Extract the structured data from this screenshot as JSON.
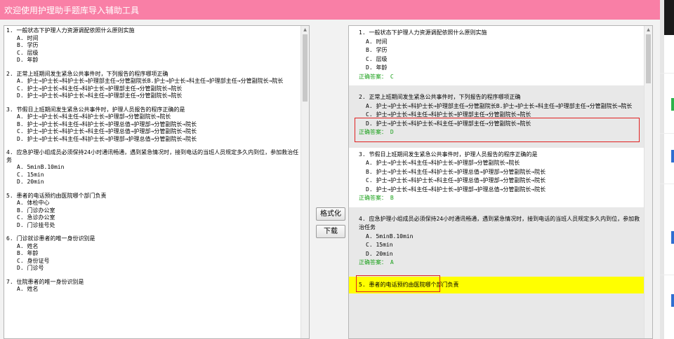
{
  "window": {
    "title": "欢迎使用护理助手题库导入辅助工具"
  },
  "buttons": {
    "format": "格式化",
    "download": "下载"
  },
  "left_questions": [
    {
      "q": "1. 一般状态下护理人力资源调配依照什么原则实施",
      "opts": [
        "A. 时间",
        "B. 学历",
        "C. 层级",
        "D. 年龄"
      ]
    },
    {
      "q": "2. 正常上班期间发生紧急公共事件时，下列报告的程序哪项正确",
      "opts": [
        "A. 护士→护士长→科护士长→护理部主任→分管副院长B.护士→护士长→科主任→护理部主任→分管副院长→院长",
        "C. 护士→护士长→科主任→科护士长→护理部主任→分管副院长→院长",
        "D. 护士→护士长→科护士长→科主任→护理部主任→分管副院长→院长"
      ]
    },
    {
      "q": "3. 节假日上班期间发生紧急公共事件时，护理人员报告的程序正确的是",
      "opts": [
        "A. 护士→护士长→科主任→科护士长→护理部→分管副院长→院长",
        "B. 护士→护士长→科主任→科护士长→护理总值→护理部→分管副院长→院长",
        "C. 护士→护士长→科护士长→科主任→护理总值→护理部→分管副院长→院长",
        "D. 护士→护士长→科主任→科护士长→护理部→护理总值→分管副院长→院长"
      ]
    },
    {
      "q": "4. 应急护理小组成员必须保持24小时通讯畅通，遇到紧急情况时，接到电话的当班人员规定多久内到位，参加救治任务",
      "opts": [
        "A. 5minB.10min",
        "C. 15min",
        "D. 20min"
      ]
    },
    {
      "q": "5. 患者的电话预约由医院哪个部门负责",
      "opts": [
        "A. 体检中心",
        "B. 门诊办公室",
        "C. 急诊办公室",
        "D. 门诊挂号处"
      ]
    },
    {
      "q": "6. 门诊就诊患者的唯一身份识别是",
      "opts": [
        "A. 姓名",
        "B. 年龄",
        "C. 身份证号",
        "D. 门诊号"
      ]
    },
    {
      "q": "7. 住院患者的唯一身份识别是",
      "opts": [
        "A. 姓名"
      ]
    }
  ],
  "right_questions": [
    {
      "q": "1. 一般状态下护理人力资源调配依照什么原则实施",
      "opts": [
        "A. 时间",
        "B. 学历",
        "C. 层级",
        "D. 年龄"
      ],
      "answer": "正确答案： C"
    },
    {
      "q": "2. 正常上班期间发生紧急公共事件时，下列报告的程序哪项正确",
      "opts": [
        "A. 护士→护士长→科护士长→护理部主任→分管副院长B.护士→护士长→科主任→护理部主任→分管副院长→院长",
        "C. 护士→护士长→科主任→科护士长→护理部主任→分管副院长→院长",
        "D. 护士→护士长→科护士长→科主任→护理部主任→分管副院长→院长"
      ],
      "answer": "正确答案： D"
    },
    {
      "q": "3. 节假日上班期间发生紧急公共事件时，护理人员报告的程序正确的是",
      "opts": [
        "A. 护士→护士长→科主任→科护士长→护理部→分管副院长→院长",
        "B. 护士→护士长→科主任→科护士长→护理总值→护理部→分管副院长→院长",
        "C. 护士→护士长→科护士长→科主任→护理总值→护理部→分管副院长→院长",
        "D. 护士→护士长→科主任→科护士长→护理部→护理总值→分管副院长→院长"
      ],
      "answer": "正确答案： B"
    },
    {
      "q": "4. 应急护理小组成员必须保持24小时通讯畅通，遇到紧急情况时，接到电话的当班人员规定多久内到位，参加救治任务",
      "opts": [
        "A. 5minB.10min",
        "C. 15min",
        "D. 20min"
      ],
      "answer": "正确答案： A"
    },
    {
      "q": "5. 患者的电话预约由医院哪个部门负责"
    }
  ],
  "colors": {
    "titlebar": "#f97fa6",
    "answer": "#1aa01a",
    "highlight_bg": "#ffff00",
    "error_box": "#e02020"
  }
}
